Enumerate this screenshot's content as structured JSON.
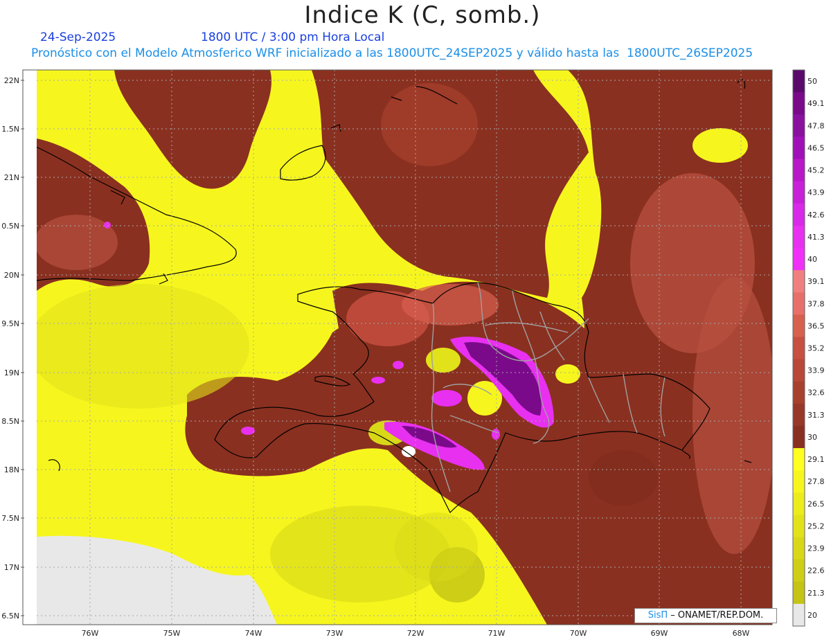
{
  "title": "Indice K (C, somb.)",
  "date": "24-Sep-2025",
  "time": "1800 UTC / 3:00 pm Hora Local",
  "description": "Pronóstico con el Modelo Atmosferico WRF inicializado a las 1800UTC_24SEP2025 y válido hasta las  1800UTC_26SEP2025",
  "map": {
    "lat_labels": [
      "22N",
      "1.5N",
      "21N",
      "0.5N",
      "20N",
      "9.5N",
      "19N",
      "8.5N",
      "18N",
      "7.5N",
      "17N",
      "6.5N"
    ],
    "lon_labels": [
      "76W",
      "75W",
      "74W",
      "73W",
      "72W",
      "71W",
      "70W",
      "69W",
      "68W"
    ]
  },
  "colorbar": {
    "labels": [
      "50",
      "49.1",
      "47.8",
      "46.5",
      "45.2",
      "43.9",
      "42.6",
      "41.3",
      "40",
      "39.1",
      "37.8",
      "36.5",
      "35.2",
      "33.9",
      "32.6",
      "31.3",
      "30",
      "29.1",
      "27.8",
      "26.5",
      "25.2",
      "23.9",
      "22.6",
      "21.3",
      "20"
    ],
    "colors": [
      "#5a0a6a",
      "#7a0a8a",
      "#8a10a0",
      "#a010b8",
      "#b818c8",
      "#c820d8",
      "#d828e8",
      "#e830f0",
      "#f030f8",
      "#f08080",
      "#e8706a",
      "#d8604e",
      "#c85040",
      "#b84838",
      "#a8402e",
      "#983828",
      "#8a3020",
      "#ffff20",
      "#f6f61e",
      "#ecec1c",
      "#e2e21a",
      "#d8d818",
      "#cece16",
      "#c4c414",
      "#e8e8e8"
    ]
  },
  "credit": {
    "brand": "SisΠ",
    "text": " – ONAMET/REP.DOM."
  }
}
